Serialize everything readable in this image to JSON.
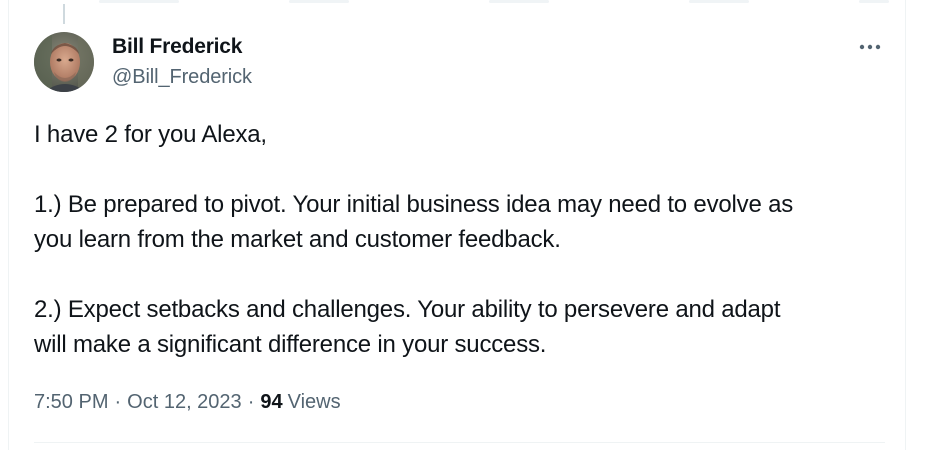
{
  "tweet": {
    "author": {
      "name": "Bill Frederick",
      "handle": "@Bill_Frederick",
      "avatar_icon": "person-avatar"
    },
    "more_icon": "more-horizontal-icon",
    "body": {
      "intro": "I have 2 for you Alexa,",
      "point1_line1": "1.) Be prepared to pivot. Your initial business idea may need to evolve as",
      "point1_line2": "you learn from the market and customer feedback.",
      "point2_line1": "2.) Expect setbacks and challenges. Your ability to persevere and adapt",
      "point2_line2": "will make a significant difference in your success."
    },
    "meta": {
      "time": "7:50 PM",
      "separator": "·",
      "date": "Oct 12, 2023",
      "views_count": "94",
      "views_label": "Views"
    }
  },
  "colors": {
    "text_primary": "#0f1419",
    "text_secondary": "#536471",
    "divider": "#eff3f4"
  }
}
